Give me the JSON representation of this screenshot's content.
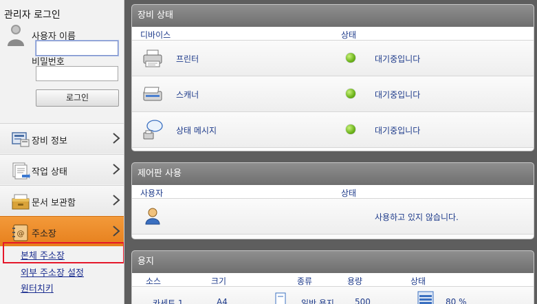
{
  "login": {
    "title": "관리자 로그인",
    "user_label": "사용자 이름",
    "user_value": "",
    "password_label": "비밀번호",
    "button": "로그인"
  },
  "nav": [
    {
      "label": "장비 정보",
      "icon": "device-info-icon"
    },
    {
      "label": "작업 상태",
      "icon": "job-status-icon"
    },
    {
      "label": "문서 보관함",
      "icon": "document-box-icon"
    },
    {
      "label": "주소장",
      "icon": "address-book-icon"
    }
  ],
  "address_sub": [
    "본체 주소장",
    "외부 주소장 설정",
    "원터치키"
  ],
  "device_status": {
    "title": "장비 상태",
    "col_device": "디바이스",
    "col_status": "상태",
    "rows": [
      {
        "name": "프린터",
        "status": "대기중입니다",
        "icon": "printer-icon"
      },
      {
        "name": "스캐너",
        "status": "대기중입니다",
        "icon": "scanner-icon"
      },
      {
        "name": "상태 메시지",
        "status": "대기중입니다",
        "icon": "message-icon"
      }
    ]
  },
  "panel_usage": {
    "title": "제어판 사용",
    "col_user": "사용자",
    "col_status": "상태",
    "row_status": "사용하고 있지 않습니다."
  },
  "paper": {
    "title": "용지",
    "cols": [
      "소스",
      "크기",
      "종류",
      "용량",
      "상태"
    ],
    "row": {
      "source": "카세트 1",
      "size": "A4",
      "type": "일반 용지",
      "capacity": "500",
      "level": "80 %"
    }
  },
  "colors": {
    "accent": "#e8841f",
    "link": "#1d3a8a",
    "highlight": "#e5162a",
    "ok": "#6bb21a"
  }
}
